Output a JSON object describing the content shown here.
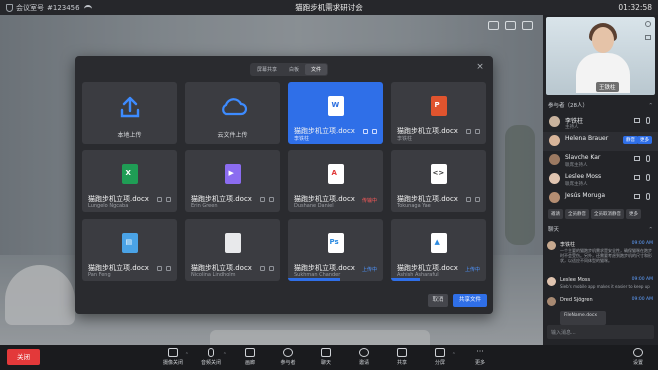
{
  "topbar": {
    "meeting_label": "会议室号",
    "meeting_id": "#123456",
    "title": "猫跑步机需求研讨会",
    "clock": "01:32:58"
  },
  "modal": {
    "tabs": [
      "屏幕共享",
      "白板",
      "文件"
    ],
    "active_tab": "文件",
    "local_upload": "本地上传",
    "cloud_upload": "云文件上传",
    "files": [
      {
        "name": "猫跑步机立项.docx",
        "owner": "李铁柱",
        "type": "word",
        "selected": true
      },
      {
        "name": "猫跑步机立项.docx",
        "owner": "李铁柱",
        "type": "ppt"
      },
      {
        "name": "猫跑步机立项.docx",
        "owner": "Lungelo Ngcaba",
        "type": "excel"
      },
      {
        "name": "猫跑步机立项.docx",
        "owner": "Erin Green",
        "type": "video"
      },
      {
        "name": "猫跑步机立项.docx",
        "owner": "Dushane Daniel",
        "type": "pdf",
        "status": "传输中"
      },
      {
        "name": "猫跑步机立项.docx",
        "owner": "Tokunaga Yae",
        "type": "code"
      },
      {
        "name": "猫跑步机立项.docx",
        "owner": "Pan Feng",
        "type": "zip"
      },
      {
        "name": "猫跑步机立项.docx",
        "owner": "Nicolina Lindholm",
        "type": "doc"
      },
      {
        "name": "猫跑步机立项.docx",
        "owner": "Sukhman Chander",
        "type": "ps",
        "status": "上传中",
        "progress": 0.55
      },
      {
        "name": "猫跑步机立项.docx",
        "owner": "Ashish Asharaful",
        "type": "image",
        "status": "上传中",
        "progress": 0.3
      }
    ],
    "cancel_label": "取消",
    "share_label": "共享文件"
  },
  "side": {
    "self_name": "王铁柱",
    "participants_label": "参与者（28人）",
    "participants": [
      {
        "name": "李铁柱",
        "role": "主持人"
      },
      {
        "name": "Helena Brauer",
        "role": "",
        "pill": "静音",
        "pill2": "更多"
      },
      {
        "name": "Slavche Kar",
        "role": "联席主持人"
      },
      {
        "name": "Leslee Moss",
        "role": "联席主持人"
      },
      {
        "name": "Jesús Moruga",
        "role": ""
      }
    ],
    "participant_actions": [
      "邀请",
      "全员静音",
      "全员取消静音",
      "更多"
    ],
    "chat_label": "聊天",
    "messages": [
      {
        "name": "李铁柱",
        "time": "09:00 AM",
        "text": "一个主要的猫跑步机需求是安全性，确保猫咪在跑步时不会受伤。另外，还需要考虑到跑步机的尺寸和形状，以适应不同体型的猫咪。"
      },
      {
        "name": "Leslee Moss",
        "time": "09:00 AM",
        "text": "Sieb's mobile app makes it easier to keep up"
      },
      {
        "name": "Dred Sjögren",
        "time": "09:00 AM",
        "text": ""
      }
    ],
    "file_card": "FileName.docx",
    "chat_placeholder": "输入消息..."
  },
  "bottom": {
    "end_label": "关闭",
    "tools": [
      "摄像关闭",
      "音频关闭",
      "画廊",
      "参与者",
      "聊天",
      "邀请",
      "共享",
      "分屏",
      "更多"
    ],
    "settings_label": "设置"
  }
}
